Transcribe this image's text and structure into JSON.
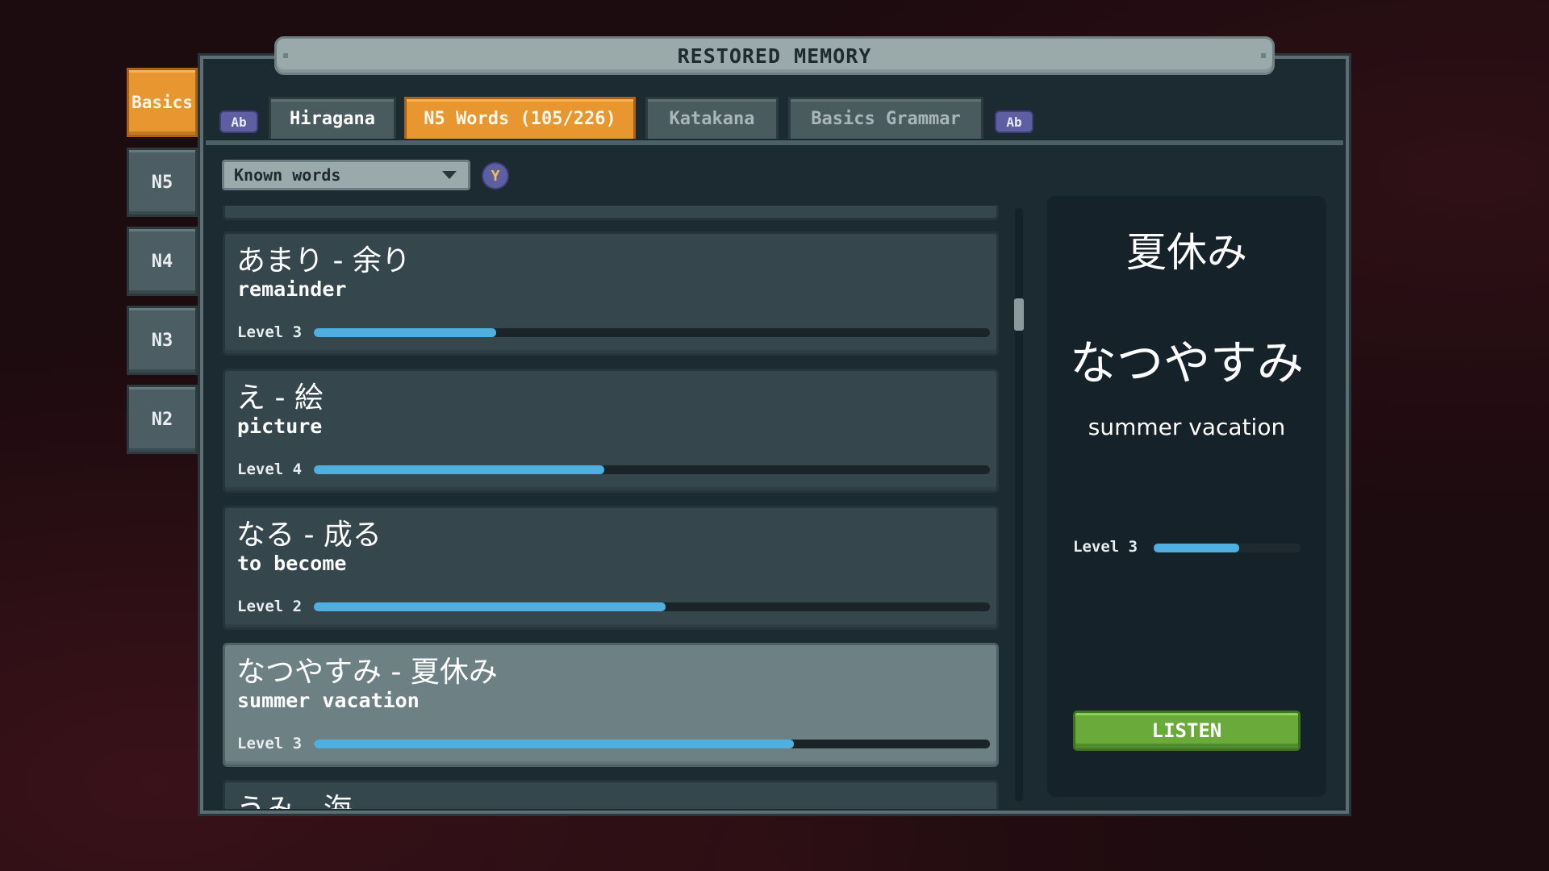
{
  "title": "RESTORED MEMORY",
  "side_tabs": [
    {
      "label": "Basics",
      "active": true
    },
    {
      "label": "N5",
      "active": false
    },
    {
      "label": "N4",
      "active": false
    },
    {
      "label": "N3",
      "active": false
    },
    {
      "label": "N2",
      "active": false
    }
  ],
  "top_tabs": {
    "prev_key": "Ab",
    "next_key": "Ab",
    "items": [
      {
        "label": "Hiragana"
      },
      {
        "label": "N5 Words (105/226)"
      },
      {
        "label": "Katakana"
      },
      {
        "label": "Basics Grammar"
      }
    ]
  },
  "filter": {
    "selected": "Known words",
    "icon": "controller-button-icon",
    "icon_glyph": "Y"
  },
  "words": [
    {
      "word": "あまり - 余り",
      "meaning": "remainder",
      "level_label": "Level 3",
      "progress": 0.27
    },
    {
      "word": "え - 絵",
      "meaning": "picture",
      "level_label": "Level 4",
      "progress": 0.43
    },
    {
      "word": "なる - 成る",
      "meaning": "to become",
      "level_label": "Level 2",
      "progress": 0.52
    },
    {
      "word": "なつやすみ - 夏休み",
      "meaning": "summer vacation",
      "level_label": "Level 3",
      "progress": 0.71,
      "selected": true
    },
    {
      "word": "うみ - 海",
      "meaning": "",
      "level_label": "",
      "progress": 0
    }
  ],
  "detail": {
    "kanji": "夏休み",
    "kana": "なつやすみ",
    "meaning": "summer vacation",
    "level_label": "Level 3",
    "progress": 0.58,
    "listen_label": "LISTEN"
  },
  "colors": {
    "accent_orange": "#e8962f",
    "progress_blue": "#4fb0df",
    "listen_green": "#6aaa3a",
    "key_purple": "#5e5fa3"
  }
}
